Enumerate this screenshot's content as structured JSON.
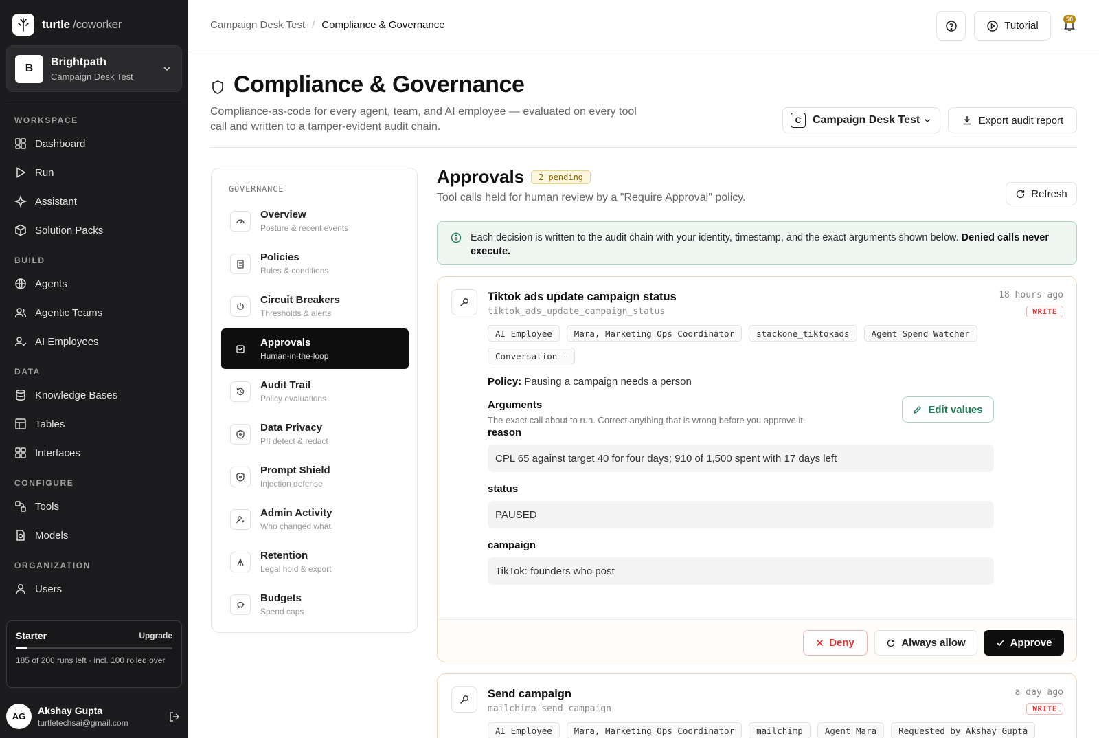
{
  "brand": {
    "name": "turtle",
    "suffix": "/coworker"
  },
  "workspace": {
    "initial": "B",
    "name": "Brightpath",
    "sub": "Campaign Desk Test"
  },
  "nav": {
    "workspace_title": "WORKSPACE",
    "dashboard": "Dashboard",
    "run": "Run",
    "assistant": "Assistant",
    "solution_packs": "Solution Packs",
    "build_title": "BUILD",
    "agents": "Agents",
    "agentic_teams": "Agentic Teams",
    "ai_employees": "AI Employees",
    "data_title": "DATA",
    "knowledge_bases": "Knowledge Bases",
    "tables": "Tables",
    "interfaces": "Interfaces",
    "configure_title": "CONFIGURE",
    "tools": "Tools",
    "models": "Models",
    "organization_title": "ORGANIZATION",
    "users": "Users"
  },
  "plan": {
    "name": "Starter",
    "upgrade": "Upgrade",
    "text": "185 of 200 runs left · incl. 100 rolled over",
    "progress": 0.075
  },
  "user": {
    "initials": "AG",
    "name": "Akshay Gupta",
    "email": "turtletechsai@gmail.com"
  },
  "topbar": {
    "crumb1": "Campaign Desk Test",
    "sep": "/",
    "crumb2": "Compliance & Governance",
    "tutorial": "Tutorial",
    "notif_count": "50"
  },
  "header": {
    "title": "Compliance & Governance",
    "desc": "Compliance-as-code for every agent, team, and AI employee — evaluated on every tool call and written to a tamper-evident audit chain.",
    "ws_badge": "C",
    "ws_select": "Campaign Desk Test",
    "export": "Export audit report"
  },
  "gov": {
    "title": "GOVERNANCE",
    "items": [
      {
        "label": "Overview",
        "sub": "Posture & recent events"
      },
      {
        "label": "Policies",
        "sub": "Rules & conditions"
      },
      {
        "label": "Circuit Breakers",
        "sub": "Thresholds & alerts"
      },
      {
        "label": "Approvals",
        "sub": "Human-in-the-loop"
      },
      {
        "label": "Audit Trail",
        "sub": "Policy evaluations"
      },
      {
        "label": "Data Privacy",
        "sub": "PII detect & redact"
      },
      {
        "label": "Prompt Shield",
        "sub": "Injection defense"
      },
      {
        "label": "Admin Activity",
        "sub": "Who changed what"
      },
      {
        "label": "Retention",
        "sub": "Legal hold & export"
      },
      {
        "label": "Budgets",
        "sub": "Spend caps"
      }
    ]
  },
  "approvals": {
    "title": "Approvals",
    "badge": "2 pending",
    "desc": "Tool calls held for human review by a \"Require Approval\" policy.",
    "refresh": "Refresh",
    "banner_text": "Each decision is written to the audit chain with your identity, timestamp, and the exact arguments shown below. ",
    "banner_bold": "Denied calls never execute."
  },
  "card1": {
    "title": "Tiktok ads update campaign status",
    "fn": "tiktok_ads_update_campaign_status",
    "time": "18 hours ago",
    "write": "WRITE",
    "chips": [
      "AI Employee",
      "Mara, Marketing Ops Coordinator",
      "stackone_tiktokads",
      "Agent Spend Watcher",
      "Conversation -"
    ],
    "policy_label": "Policy:",
    "policy": " Pausing a campaign needs a person",
    "args_title": "Arguments",
    "args_desc": "The exact call about to run. Correct anything that is wrong before you approve it.",
    "edit": "Edit values",
    "fields": [
      {
        "label": "reason",
        "value": "CPL 65 against target 40 for four days; 910 of 1,500 spent with 17 days left"
      },
      {
        "label": "status",
        "value": "PAUSED"
      },
      {
        "label": "campaign",
        "value": "TikTok: founders who post"
      }
    ],
    "deny": "Deny",
    "always": "Always allow",
    "approve": "Approve"
  },
  "card2": {
    "title": "Send campaign",
    "fn": "mailchimp_send_campaign",
    "time": "a day ago",
    "write": "WRITE",
    "chips": [
      "AI Employee",
      "Mara, Marketing Ops Coordinator",
      "mailchimp",
      "Agent Mara",
      "Requested by Akshay Gupta"
    ]
  }
}
